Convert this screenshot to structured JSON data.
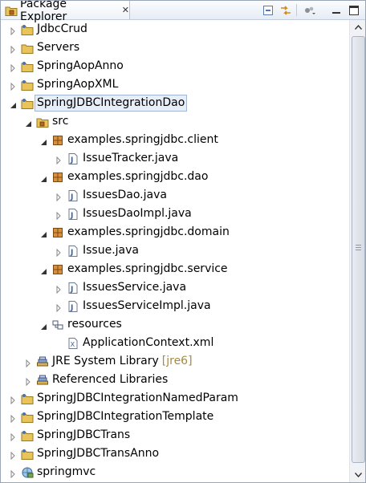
{
  "view": {
    "title": "Package Explorer",
    "close_glyph": "✕"
  },
  "toolbar": {
    "buttons": [
      "collapse-all-icon",
      "link-with-editor-icon",
      "view-menu-icon",
      "minimize-icon",
      "maximize-icon"
    ]
  },
  "tree": {
    "items": [
      {
        "label": "JdbcCrud",
        "icon": "java-project-icon",
        "expanded": false
      },
      {
        "label": "Servers",
        "icon": "folder-icon",
        "expanded": false
      },
      {
        "label": "SpringAopAnno",
        "icon": "java-project-icon",
        "expanded": false
      },
      {
        "label": "SpringAopXML",
        "icon": "java-project-icon",
        "expanded": false
      },
      {
        "label": "SpringJDBCIntegrationDao",
        "icon": "java-project-icon",
        "expanded": true,
        "selected": true
      },
      {
        "label": "src",
        "icon": "source-folder-icon",
        "expanded": true
      },
      {
        "label": "examples.springjdbc.client",
        "icon": "package-icon",
        "expanded": true
      },
      {
        "label": "IssueTracker.java",
        "icon": "java-file-icon",
        "expanded": false
      },
      {
        "label": "examples.springjdbc.dao",
        "icon": "package-icon",
        "expanded": true
      },
      {
        "label": "IssuesDao.java",
        "icon": "java-file-icon",
        "expanded": false
      },
      {
        "label": "IssuesDaoImpl.java",
        "icon": "java-file-icon",
        "expanded": false
      },
      {
        "label": "examples.springjdbc.domain",
        "icon": "package-icon",
        "expanded": true
      },
      {
        "label": "Issue.java",
        "icon": "java-file-icon",
        "expanded": false
      },
      {
        "label": "examples.springjdbc.service",
        "icon": "package-icon",
        "expanded": true
      },
      {
        "label": "IssuesService.java",
        "icon": "java-file-icon",
        "expanded": false
      },
      {
        "label": "IssuesServiceImpl.java",
        "icon": "java-file-icon",
        "expanded": false
      },
      {
        "label": "resources",
        "icon": "resource-folder-icon",
        "expanded": true
      },
      {
        "label": "ApplicationContext.xml",
        "icon": "xml-file-icon"
      },
      {
        "label": "JRE System Library",
        "decoration": "[jre6]",
        "icon": "library-icon",
        "expanded": false
      },
      {
        "label": "Referenced Libraries",
        "icon": "library-icon",
        "expanded": false
      },
      {
        "label": "SpringJDBCIntegrationNamedParam",
        "icon": "java-project-icon",
        "expanded": false
      },
      {
        "label": "SpringJDBCIntegrationTemplate",
        "icon": "java-project-icon",
        "expanded": false
      },
      {
        "label": "SpringJDBCTrans",
        "icon": "java-project-icon",
        "expanded": false
      },
      {
        "label": "SpringJDBCTransAnno",
        "icon": "java-project-icon",
        "expanded": false
      },
      {
        "label": "springmvc",
        "icon": "web-project-icon",
        "expanded": false
      }
    ]
  },
  "colors": {
    "selection": "#e8eef8",
    "decoration": "#a88a3a",
    "folder": "#e8c25a",
    "package": "#b5651d"
  }
}
